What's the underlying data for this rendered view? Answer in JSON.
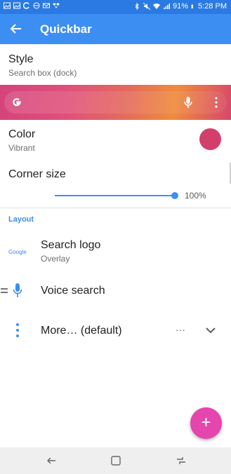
{
  "status_bar": {
    "battery": "91%",
    "time": "5:28 PM"
  },
  "app_bar": {
    "title": "Quickbar"
  },
  "style_setting": {
    "title": "Style",
    "value": "Search box (dock)"
  },
  "color_setting": {
    "title": "Color",
    "value": "Vibrant",
    "swatch_color": "#d23f6a"
  },
  "corner_setting": {
    "title": "Corner size",
    "value_label": "100%",
    "value": 1.0
  },
  "layout_section": {
    "label": "Layout",
    "items": [
      {
        "title": "Search logo",
        "subtitle": "Overlay",
        "icon": "google-wordmark-icon",
        "icon_text": "Google"
      },
      {
        "title": "Voice search",
        "icon": "microphone-icon"
      },
      {
        "title": "More… (default)",
        "icon": "more-vert-icon",
        "trailing": "···"
      }
    ]
  },
  "colors": {
    "status_bar": "#2b7ae3",
    "app_bar": "#3d8ef3",
    "accent": "#3d8ef3",
    "fab": "#e546ad"
  },
  "fab": {
    "icon": "plus-icon",
    "label": "+"
  }
}
